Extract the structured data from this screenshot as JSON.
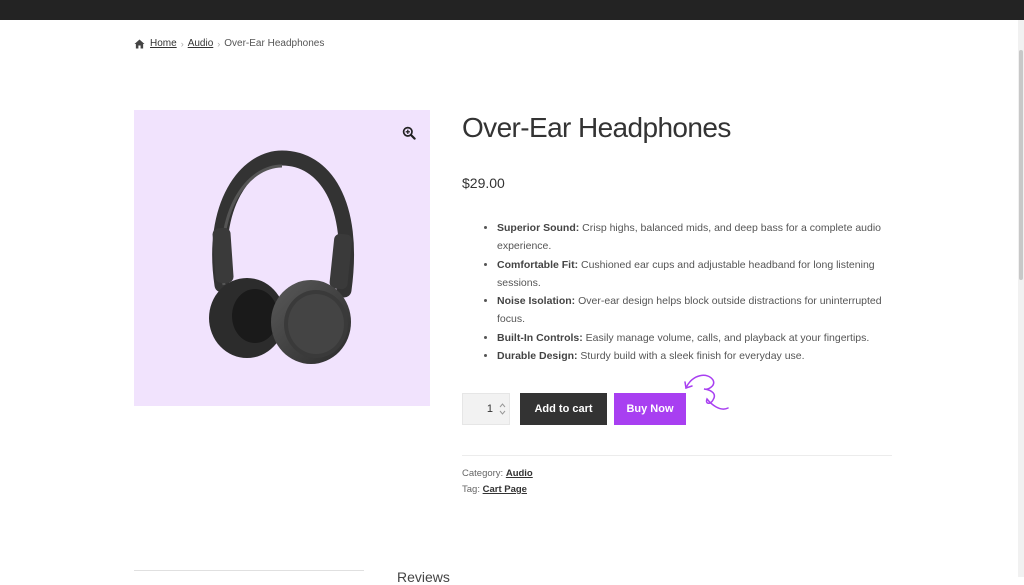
{
  "breadcrumb": {
    "home": "Home",
    "category": "Audio",
    "current": "Over-Ear Headphones",
    "separator": "›"
  },
  "product": {
    "title": "Over-Ear Headphones",
    "price": "$29.00",
    "features": [
      {
        "label": "Superior Sound:",
        "text": " Crisp highs, balanced mids, and deep bass for a complete audio experience."
      },
      {
        "label": "Comfortable Fit:",
        "text": " Cushioned ear cups and adjustable headband for long listening sessions."
      },
      {
        "label": "Noise Isolation:",
        "text": " Over-ear design helps block outside distractions for uninterrupted focus."
      },
      {
        "label": "Built-In Controls:",
        "text": " Easily manage volume, calls, and playback at your fingertips."
      },
      {
        "label": "Durable Design:",
        "text": " Sturdy build with a sleek finish for everyday use."
      }
    ],
    "quantity": "1",
    "add_to_cart": "Add to cart",
    "buy_now": "Buy Now",
    "category_label": "Category: ",
    "category_value": "Audio",
    "tag_label": "Tag: ",
    "tag_value": "Cart Page",
    "image_background": "#f1e3fd"
  },
  "tabs": {
    "first": "Reviews"
  },
  "colors": {
    "accent": "#a83ff1",
    "dark_button": "#333333",
    "topbar": "#232323"
  },
  "icons": {
    "home": "home-icon",
    "zoom": "zoom-in-icon",
    "quantity_spinner": "spinner-icon"
  }
}
